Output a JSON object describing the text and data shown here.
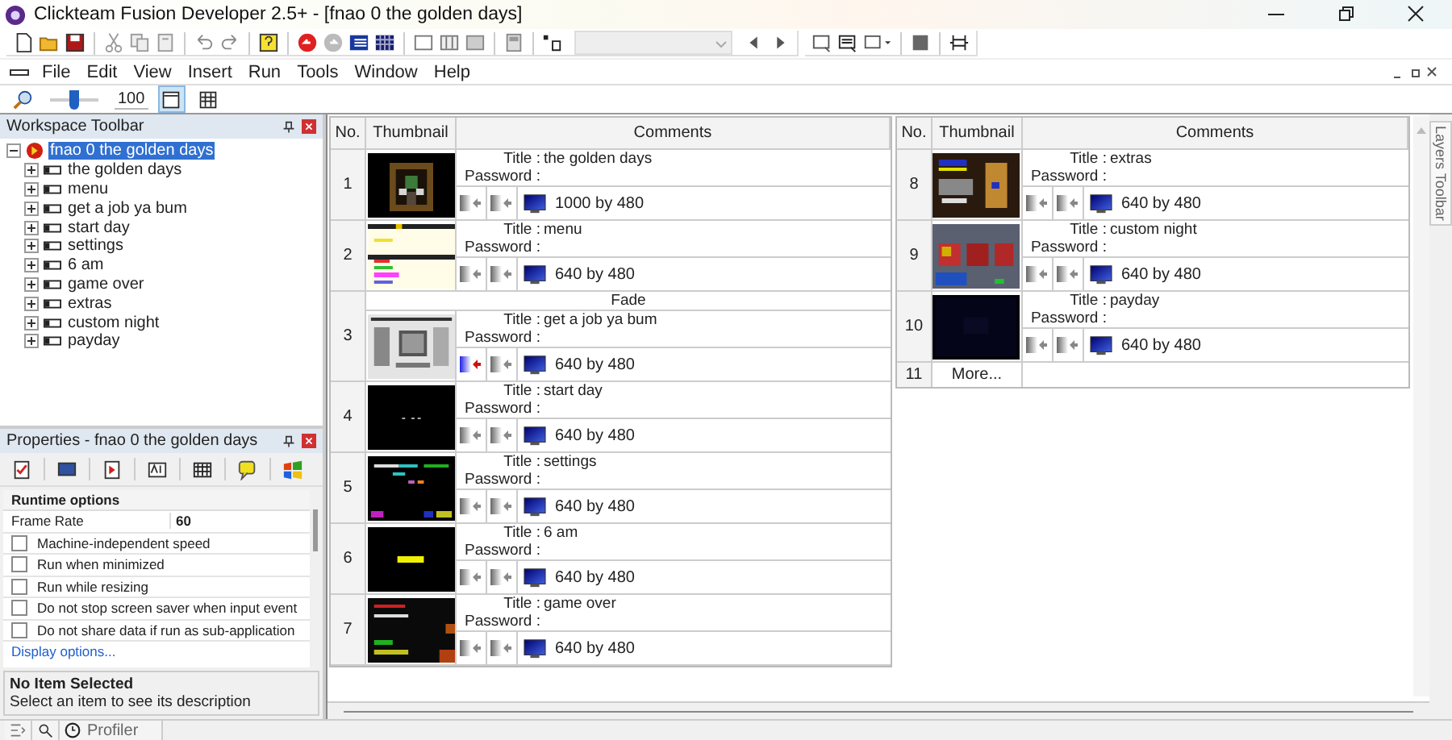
{
  "window": {
    "title": "Clickteam Fusion Developer 2.5+ - [fnao 0 the golden days]"
  },
  "menu": [
    "File",
    "Edit",
    "View",
    "Insert",
    "Run",
    "Tools",
    "Window",
    "Help"
  ],
  "zoom": {
    "level": 0.5,
    "value": "100",
    "views": [
      {
        "selected": true
      },
      {
        "selected": false
      }
    ]
  },
  "workspace": {
    "title": "Workspace Toolbar",
    "tree": [
      {
        "label": "fnao 0 the golden days",
        "selected": true,
        "expanded": true,
        "children": [
          {
            "label": "the golden days",
            "selected": false,
            "expanded": false
          },
          {
            "label": "menu",
            "selected": false,
            "expanded": false
          },
          {
            "label": "get a job ya bum",
            "selected": false,
            "expanded": false
          },
          {
            "label": "start day",
            "selected": false,
            "expanded": false
          },
          {
            "label": "settings",
            "selected": false,
            "expanded": false
          },
          {
            "label": "6 am",
            "selected": false,
            "expanded": false
          },
          {
            "label": "game over",
            "selected": false,
            "expanded": false
          },
          {
            "label": "extras",
            "selected": false,
            "expanded": false
          },
          {
            "label": "custom night",
            "selected": false,
            "expanded": false
          },
          {
            "label": "payday",
            "selected": false,
            "expanded": false
          }
        ]
      }
    ]
  },
  "properties": {
    "title": "Properties - fnao 0 the golden days",
    "section": "Runtime options",
    "rows": [
      {
        "kind": "value",
        "label": "Frame Rate",
        "value": "60"
      },
      {
        "kind": "check",
        "label": "Machine-independent speed",
        "checked": false
      },
      {
        "kind": "check",
        "label": "Run when minimized",
        "checked": false
      },
      {
        "kind": "check",
        "label": "Run while resizing",
        "checked": false
      },
      {
        "kind": "check",
        "label": "Do not stop screen saver when input event",
        "checked": false
      },
      {
        "kind": "check",
        "label": "Do not share data if run as sub-application",
        "checked": false
      }
    ],
    "link": "Display options...",
    "description": {
      "title": "No Item Selected",
      "text": "Select an item to see its description"
    }
  },
  "storyboard": {
    "tables": [
      {
        "columns": [
          "No.",
          "Thumbnail",
          "Comments"
        ],
        "frames": [
          {
            "no": "1",
            "title_label": "Title :",
            "title": "the golden days",
            "password_label": "Password :",
            "size": "1000 by 480",
            "transition_in": false
          },
          {
            "no": "2",
            "title_label": "Title :",
            "title": "menu",
            "password_label": "Password :",
            "size": "640 by 480",
            "transition_in": false
          },
          {
            "no": "3",
            "transition_label": "Fade",
            "title_label": "Title :",
            "title": "get a job ya bum",
            "password_label": "Password :",
            "size": "640 by 480",
            "transition_in": true
          },
          {
            "no": "4",
            "title_label": "Title :",
            "title": "start day",
            "password_label": "Password :",
            "size": "640 by 480",
            "transition_in": false
          },
          {
            "no": "5",
            "title_label": "Title :",
            "title": "settings",
            "password_label": "Password :",
            "size": "640 by 480",
            "transition_in": false
          },
          {
            "no": "6",
            "title_label": "Title :",
            "title": "6 am",
            "password_label": "Password :",
            "size": "640 by 480",
            "transition_in": false
          },
          {
            "no": "7",
            "title_label": "Title :",
            "title": "game over",
            "password_label": "Password :",
            "size": "640 by 480",
            "transition_in": false
          }
        ]
      },
      {
        "columns": [
          "No.",
          "Thumbnail",
          "Comments"
        ],
        "frames": [
          {
            "no": "8",
            "title_label": "Title :",
            "title": "extras",
            "password_label": "Password :",
            "size": "640 by 480",
            "transition_in": false
          },
          {
            "no": "9",
            "title_label": "Title :",
            "title": "custom night",
            "password_label": "Password :",
            "size": "640 by 480",
            "transition_in": false
          },
          {
            "no": "10",
            "title_label": "Title :",
            "title": "payday",
            "password_label": "Password :",
            "size": "640 by 480",
            "transition_in": false
          }
        ],
        "more": {
          "no": "11",
          "label": "More..."
        }
      }
    ]
  },
  "layers_tab": "Layers Toolbar",
  "bottom_tab": "Profiler"
}
